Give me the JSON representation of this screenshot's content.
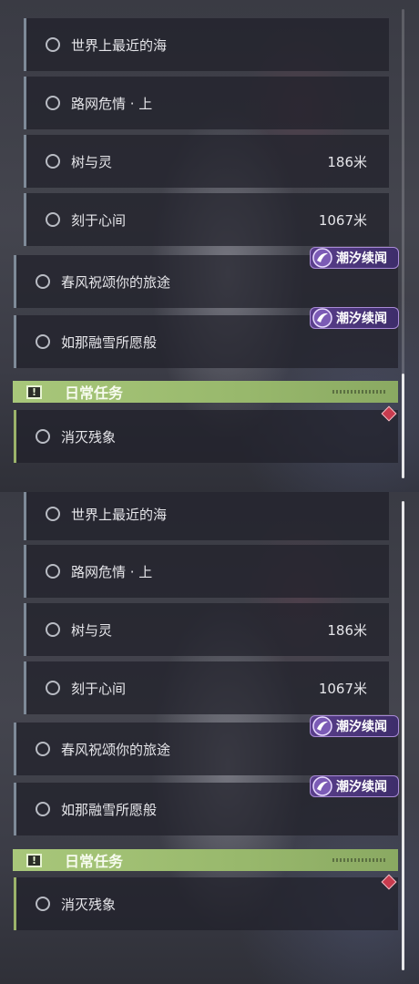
{
  "quests": {
    "main": [
      {
        "title": "世界上最近的海",
        "distance": ""
      },
      {
        "title": "路网危情 · 上",
        "distance": ""
      },
      {
        "title": "树与灵",
        "distance": "186米"
      },
      {
        "title": "刻于心间",
        "distance": "1067米"
      }
    ],
    "side": [
      {
        "title": "春风祝颂你的旅途",
        "badge": "潮汐续闻"
      },
      {
        "title": "如那融雪所愿般",
        "badge": "潮汐续闻"
      }
    ]
  },
  "daily": {
    "section_title": "日常任务",
    "items": [
      {
        "title": "消灭残象"
      }
    ]
  },
  "colors": {
    "section_green": "#a8c77a",
    "badge_purple": "#5a3f8c",
    "pin_red": "#c83b4e"
  },
  "icons": {
    "quest_status": "ring-icon",
    "badge_logo": "tidal-crest-icon",
    "section": "exclamation-icon",
    "tracker": "diamond-pin-icon"
  }
}
